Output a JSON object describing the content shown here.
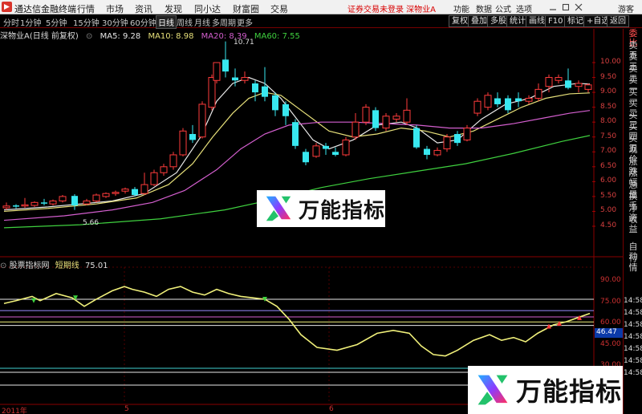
{
  "app": {
    "title": "通达信金融终端"
  },
  "menu": {
    "items": [
      "行情",
      "市场",
      "资讯",
      "发现",
      "同小达",
      "财富圈",
      "交易"
    ]
  },
  "status": {
    "text": "证券交易未登录  深物业A"
  },
  "menu_right": {
    "items": [
      "功能",
      "数据",
      "公式",
      "选项"
    ],
    "user": "游客"
  },
  "periods": [
    "分时",
    "1分钟",
    "5分钟",
    "15分钟",
    "30分钟",
    "60分钟",
    "日线",
    "周线",
    "月线",
    "多周期",
    "更多"
  ],
  "active_period": "日线",
  "toolbar_right": [
    "复权",
    "叠加",
    "多股",
    "统计",
    "画线",
    "F10",
    "标记",
    "+自选",
    "返回"
  ],
  "main_chart": {
    "title": "深物业A(日线 前复权)",
    "ma": [
      {
        "label": "MA5: 9.28",
        "color": "#e8e8e8"
      },
      {
        "label": "MA10: 8.98",
        "color": "#e7e07a"
      },
      {
        "label": "MA20: 8.39",
        "color": "#d45fcf"
      },
      {
        "label": "MA60: 7.55",
        "color": "#3fd13f"
      }
    ],
    "high_label": "10.71",
    "low_label": "5.66",
    "price_ticks": [
      "10.00",
      "9.50",
      "9.00",
      "8.50",
      "8.00",
      "7.50",
      "7.00",
      "6.50",
      "6.00",
      "5.50",
      "5.00",
      "4.50"
    ]
  },
  "right_tabs": [
    "委比",
    "卖五",
    "卖三",
    "卖二",
    "卖一",
    "买一",
    "买二",
    "买三",
    "买四",
    "买五",
    "现价",
    "涨跌",
    "涨幅",
    "总量",
    "换手",
    "净资",
    "收益",
    "自动",
    "行情"
  ],
  "indicator": {
    "title": "股票指标网",
    "label": "短期线",
    "value": "75.01",
    "ticks": [
      "90.00",
      "75.00",
      "60.00",
      "45.00",
      "30.00"
    ],
    "current": "46.47",
    "time_labels": [
      "14:58",
      "14:58",
      "14:58",
      "14:58",
      "14:58",
      "14:58",
      "14:58"
    ]
  },
  "xaxis": {
    "labels": [
      "2011年",
      "5",
      "6"
    ]
  },
  "watermark": {
    "text": "万能指标"
  },
  "colors": {
    "up": "#ff3b3b",
    "down": "#38e8f0",
    "ma5": "#e8e8e8",
    "ma10": "#e7e07a",
    "ma20": "#d45fcf",
    "ma60": "#3fd13f",
    "indicator_line": "#f0f07a"
  }
}
